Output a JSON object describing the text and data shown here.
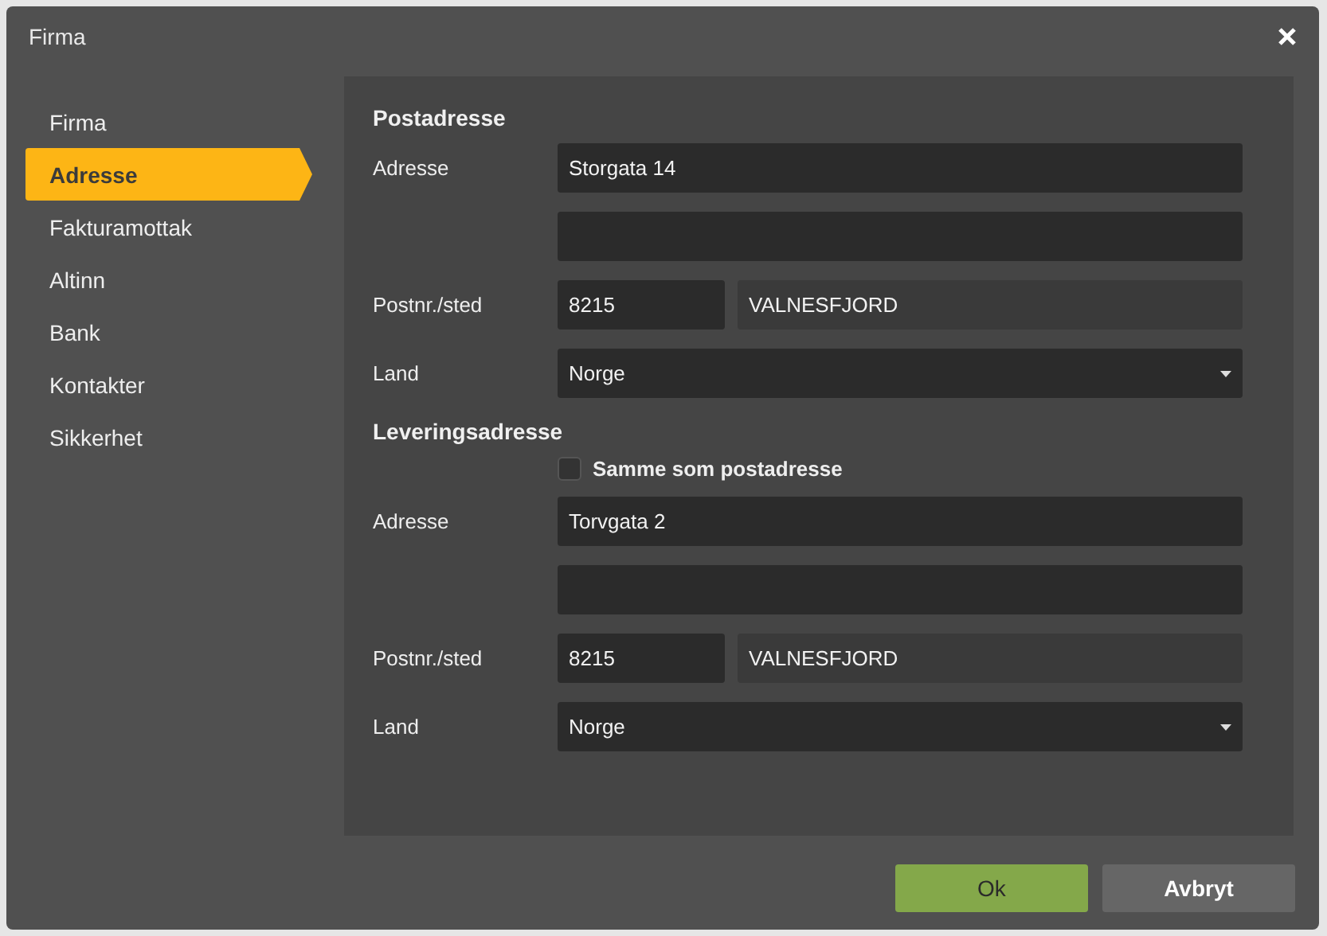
{
  "dialog": {
    "title": "Firma"
  },
  "sidebar": {
    "items": [
      {
        "label": "Firma",
        "selected": false
      },
      {
        "label": "Adresse",
        "selected": true
      },
      {
        "label": "Fakturamottak",
        "selected": false
      },
      {
        "label": "Altinn",
        "selected": false
      },
      {
        "label": "Bank",
        "selected": false
      },
      {
        "label": "Kontakter",
        "selected": false
      },
      {
        "label": "Sikkerhet",
        "selected": false
      }
    ]
  },
  "sections": [
    {
      "title": "Postadresse",
      "fields": [
        {
          "kind": "text",
          "label": "Adresse",
          "value": "Storgata 14"
        },
        {
          "kind": "text"
        },
        {
          "kind": "postal",
          "label": "Postnr./sted",
          "postcode": "8215",
          "city": "VALNESFJORD"
        },
        {
          "kind": "select",
          "label": "Land",
          "value": "Norge"
        }
      ]
    },
    {
      "title": "Leveringsadresse",
      "fields": [
        {
          "kind": "checkbox",
          "text": "Samme som postadresse",
          "checked": false
        },
        {
          "kind": "text",
          "label": "Adresse",
          "value": "Torvgata 2"
        },
        {
          "kind": "text"
        },
        {
          "kind": "postal",
          "label": "Postnr./sted",
          "postcode": "8215",
          "city": "VALNESFJORD"
        },
        {
          "kind": "select",
          "label": "Land",
          "value": "Norge"
        }
      ]
    }
  ],
  "buttons": [
    {
      "label": "Ok",
      "kind": "primary"
    },
    {
      "label": "Avbryt",
      "kind": "secondary"
    }
  ]
}
